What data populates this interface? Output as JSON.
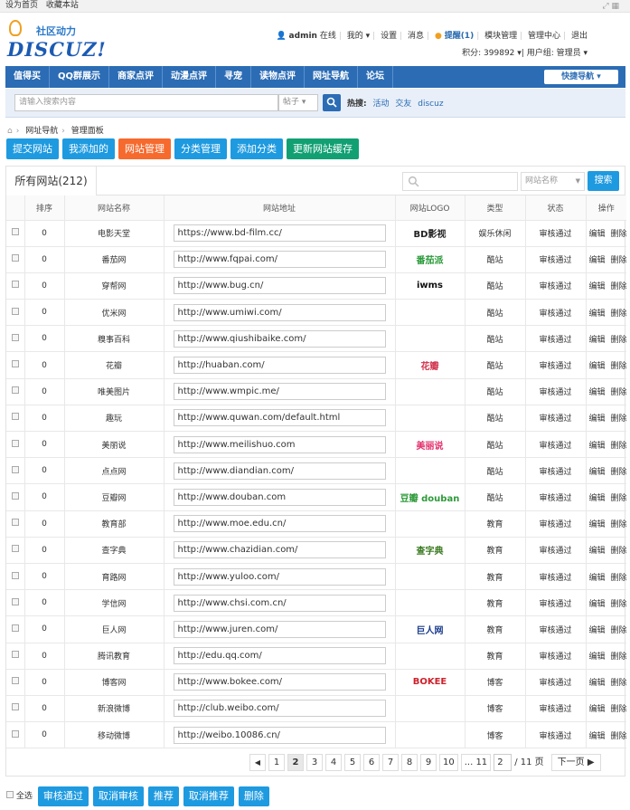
{
  "topbar": {
    "set_home": "设为首页",
    "bookmark": "收藏本站"
  },
  "logo": {
    "slogan": "社区动力",
    "brand": "DISCUZ!"
  },
  "user": {
    "name": "admin",
    "status": "在线",
    "mine": "我的",
    "settings": "设置",
    "messages": "消息",
    "remind": "提醒(1)",
    "module_mgmt": "模块管理",
    "admin_center": "管理中心",
    "logout": "退出",
    "credits": "积分: 399892",
    "group": "用户组: 管理员"
  },
  "nav": {
    "items": [
      "值得买",
      "QQ群展示",
      "商家点评",
      "动漫点评",
      "寻宠",
      "读物点评",
      "网址导航",
      "论坛"
    ],
    "quick": "快捷导航"
  },
  "search": {
    "placeholder": "请输入搜索内容",
    "type": "帖子",
    "hot_label": "热搜:",
    "hot": [
      "活动",
      "交友",
      "discuz"
    ]
  },
  "breadcrumb": {
    "nav": "网址导航",
    "panel": "管理面板"
  },
  "actions": [
    "提交网站",
    "我添加的",
    "网站管理",
    "分类管理",
    "添加分类",
    "更新网站缓存"
  ],
  "panel": {
    "tab": "所有网站(212)",
    "filter_select": "网站名称",
    "search_button": "搜索",
    "headers": [
      "",
      "排序",
      "网站名称",
      "网站地址",
      "网站LOGO",
      "类型",
      "状态",
      "操作"
    ],
    "edit": "编辑",
    "delete": "删除",
    "rows": [
      {
        "order": "0",
        "name": "电影天堂",
        "url": "https://www.bd-film.cc/",
        "logo": "BD影视",
        "type": "娱乐休闲",
        "status": "审核通过"
      },
      {
        "order": "0",
        "name": "番茄网",
        "url": "http://www.fqpai.com/",
        "logo": "番茄派",
        "type": "酷站",
        "status": "审核通过"
      },
      {
        "order": "0",
        "name": "穿帮网",
        "url": "http://www.bug.cn/",
        "logo": "iwms",
        "type": "酷站",
        "status": "审核通过"
      },
      {
        "order": "0",
        "name": "优米网",
        "url": "http://www.umiwi.com/",
        "logo": "",
        "type": "酷站",
        "status": "审核通过"
      },
      {
        "order": "0",
        "name": "糗事百科",
        "url": "http://www.qiushibaike.com/",
        "logo": "",
        "type": "酷站",
        "status": "审核通过"
      },
      {
        "order": "0",
        "name": "花瓣",
        "url": "http://huaban.com/",
        "logo": "花瓣",
        "type": "酷站",
        "status": "审核通过"
      },
      {
        "order": "0",
        "name": "唯美图片",
        "url": "http://www.wmpic.me/",
        "logo": "",
        "type": "酷站",
        "status": "审核通过"
      },
      {
        "order": "0",
        "name": "趣玩",
        "url": "http://www.quwan.com/default.html",
        "logo": "",
        "type": "酷站",
        "status": "审核通过"
      },
      {
        "order": "0",
        "name": "美丽说",
        "url": "http://www.meilishuo.com",
        "logo": "美丽说",
        "type": "酷站",
        "status": "审核通过"
      },
      {
        "order": "0",
        "name": "点点网",
        "url": "http://www.diandian.com/",
        "logo": "",
        "type": "酷站",
        "status": "审核通过"
      },
      {
        "order": "0",
        "name": "豆瓣网",
        "url": "http://www.douban.com",
        "logo": "豆瓣 douban",
        "type": "酷站",
        "status": "审核通过"
      },
      {
        "order": "0",
        "name": "教育部",
        "url": "http://www.moe.edu.cn/",
        "logo": "",
        "type": "教育",
        "status": "审核通过"
      },
      {
        "order": "0",
        "name": "查字典",
        "url": "http://www.chazidian.com/",
        "logo": "查字典",
        "type": "教育",
        "status": "审核通过"
      },
      {
        "order": "0",
        "name": "育路网",
        "url": "http://www.yuloo.com/",
        "logo": "",
        "type": "教育",
        "status": "审核通过"
      },
      {
        "order": "0",
        "name": "学信网",
        "url": "http://www.chsi.com.cn/",
        "logo": "",
        "type": "教育",
        "status": "审核通过"
      },
      {
        "order": "0",
        "name": "巨人网",
        "url": "http://www.juren.com/",
        "logo": "巨人网",
        "type": "教育",
        "status": "审核通过"
      },
      {
        "order": "0",
        "name": "腾讯教育",
        "url": "http://edu.qq.com/",
        "logo": "",
        "type": "教育",
        "status": "审核通过"
      },
      {
        "order": "0",
        "name": "博客网",
        "url": "http://www.bokee.com/",
        "logo": "BOKEE",
        "type": "博客",
        "status": "审核通过"
      },
      {
        "order": "0",
        "name": "新浪微博",
        "url": "http://club.weibo.com/",
        "logo": "",
        "type": "博客",
        "status": "审核通过"
      },
      {
        "order": "0",
        "name": "移动微博",
        "url": "http://weibo.10086.cn/",
        "logo": "",
        "type": "博客",
        "status": "审核通过"
      }
    ]
  },
  "pager": {
    "prev": "◀",
    "pages": [
      "1",
      "2",
      "3",
      "4",
      "5",
      "6",
      "7",
      "8",
      "9",
      "10",
      "... 11"
    ],
    "current": "2",
    "input": "2",
    "total": "/ 11 页",
    "next": "下一页 ▶"
  },
  "bottom": {
    "select_all": "全选",
    "buttons": [
      "审核通过",
      "取消审核",
      "推荐",
      "取消推荐",
      "删除"
    ]
  },
  "colors": {
    "nav": "#2b6cb5",
    "button": "#1e9ae0",
    "active": "#f66a2e",
    "green": "#12a073"
  }
}
